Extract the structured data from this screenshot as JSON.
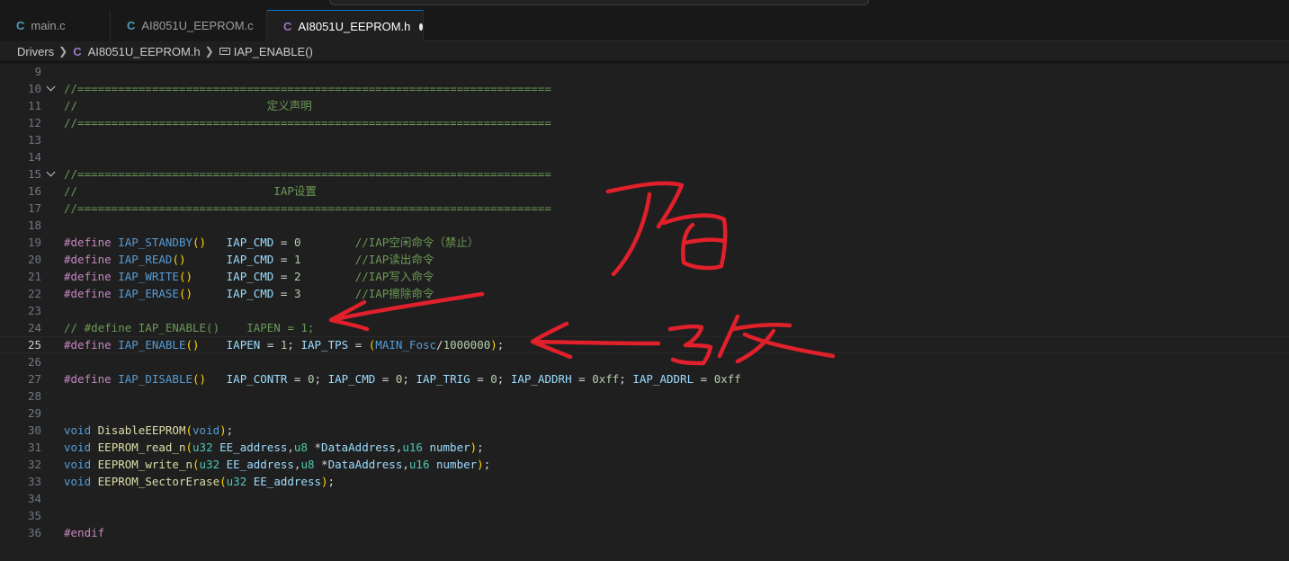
{
  "tabs": [
    {
      "icon": "C",
      "label": "main.c"
    },
    {
      "icon": "C",
      "label": "AI8051U_EEPROM.c"
    },
    {
      "icon": "C",
      "label": "AI8051U_EEPROM.h"
    }
  ],
  "breadcrumb": {
    "folder": "Drivers",
    "file_icon": "C",
    "file": "AI8051U_EEPROM.h",
    "symbol": "IAP_ENABLE()"
  },
  "lines": {
    "l9": "9",
    "l10": "10",
    "l11": "11",
    "l12": "12",
    "l13": "13",
    "l14": "14",
    "l15": "15",
    "l16": "16",
    "l17": "17",
    "l18": "18",
    "l19": "19",
    "l20": "20",
    "l21": "21",
    "l22": "22",
    "l23": "23",
    "l24": "24",
    "l25": "25",
    "l26": "26",
    "l27": "27",
    "l28": "28",
    "l29": "29",
    "l30": "30",
    "l31": "31",
    "l32": "32",
    "l33": "33",
    "l34": "34",
    "l35": "35",
    "l36": "36"
  },
  "code": {
    "sep": "//======================================================================",
    "c11": "//                            定义声明",
    "c16": "//                             IAP设置",
    "define": "#define",
    "standby": "IAP_STANDBY",
    "read": "IAP_READ",
    "write": "IAP_WRITE",
    "erase": "IAP_ERASE",
    "enable": "IAP_ENABLE",
    "disable": "IAP_DISABLE",
    "cmd": "IAP_CMD",
    "n0": "0",
    "n1": "1",
    "n2": "2",
    "n3": "3",
    "cm19": "//IAP空闲命令（禁止）",
    "cm20": "//IAP读出命令",
    "cm21": "//IAP写入命令",
    "cm22": "//IAP擦除命令",
    "l24": "// #define IAP_ENABLE()    IAPEN = 1;",
    "iapen": "IAPEN",
    "tps": "IAP_TPS",
    "mainfosc": "MAIN_Fosc",
    "n1m": "1000000",
    "contr": "IAP_CONTR",
    "trig": "IAP_TRIG",
    "addrh": "IAP_ADDRH",
    "addrl": "IAP_ADDRL",
    "hexff": "0xff",
    "void": "void",
    "dis_fn": "DisableEEPROM",
    "read_fn": "EEPROM_read_n",
    "write_fn": "EEPROM_write_n",
    "erase_fn": "EEPROM_SectorErase",
    "u32": "u32",
    "u8": "u8",
    "u16": "u16",
    "ee_address": "EE_address",
    "data_address": "DataAddress",
    "number": "number",
    "endif": "#endif"
  },
  "colors": {
    "annotation": "#e0202a",
    "accent": "#0078d4"
  },
  "annotations": {
    "top": "原",
    "bottom": "改"
  }
}
